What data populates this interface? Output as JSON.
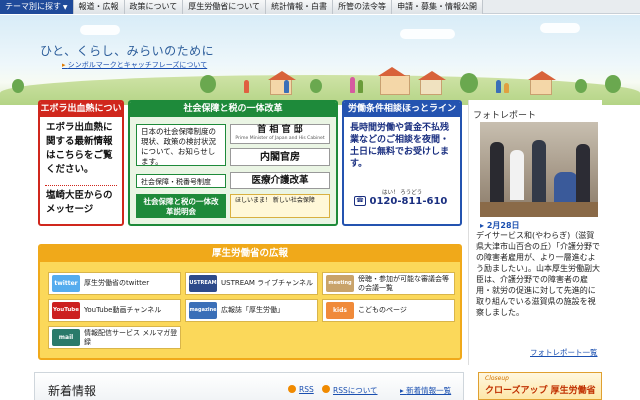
{
  "nav": {
    "items": [
      "テーマ別に探す",
      "報道・広報",
      "政策について",
      "厚生労働省について",
      "統計情報・白書",
      "所管の法令等",
      "申請・募集・情報公開"
    ]
  },
  "hero": {
    "tagline": "ひと、くらし、みらいのために",
    "link": "シンボルマークとキャッチフレーズについて"
  },
  "ebola": {
    "header": "エボラ出血熱について",
    "body": "エボラ出血熱に関する最新情報はこちらをご覧ください。",
    "message": "塩崎大臣からのメッセージ"
  },
  "tax": {
    "header": "社会保障と税の一体改革",
    "news_link": "日本の社会保障制度の現状、政策の検討状況について、お知らせします。",
    "kantei_top": "首 相 官 邸",
    "kantei_sub": "Prime Minister of Japan and His Cabinet",
    "naikaku": "内閣官房",
    "mynumber": "社会保障・税番号制度",
    "iryo": "医療介護改革",
    "setsumeikai": "社会保障と税の一体改革説明会",
    "kids": "ほしいまま！ 新しい社会保障"
  },
  "labor": {
    "header": "労働条件相談ほっとライン",
    "body": "長時間労働や賃金不払残業などのご相談を夜間・土日に無料でお受けします。",
    "phone_caption": "はい！ ろうどう",
    "phone": "0120-811-610"
  },
  "photo": {
    "title": "フォトレポート",
    "date": "2月28日",
    "text": "デイサービス和(やわらぎ)（滋賀県大津市山百合の丘）「介護分野での障害者雇用が、より一層進むよう励ましたい」。山本厚生労働副大臣は、介護分野での障害者の雇用・就労の促進に対して先進的に取り組んでいる滋賀県の施設を視察しました。",
    "more": "フォトレポート一覧"
  },
  "kouhou": {
    "header": "厚生労働省の広報",
    "items": [
      {
        "label": "厚生労働省のtwitter",
        "icon": "twitter"
      },
      {
        "label": "USTREAM ライブチャンネル",
        "icon": "USTREAM"
      },
      {
        "label": "傍聴・参加が可能な審議会等の会議一覧",
        "icon": "meeting"
      },
      {
        "label": "YouTube動画チャンネル",
        "icon": "YouTube"
      },
      {
        "label": "広報誌「厚生労働」",
        "icon": "magazine"
      },
      {
        "label": "こどものページ",
        "icon": "kids"
      },
      {
        "label": "情報配信サービス メルマガ登録",
        "icon": "mail"
      }
    ]
  },
  "news": {
    "title": "新着情報",
    "rss": "RSS",
    "rss_about": "RSSについて",
    "list": "新着情報一覧"
  },
  "closeup": {
    "small": "Closeup",
    "label": "クローズアップ 厚生労働省"
  },
  "colors": {
    "red": "#d0271d",
    "green": "#1e8a3a",
    "blue": "#2453b0",
    "orange": "#f0a91a"
  }
}
